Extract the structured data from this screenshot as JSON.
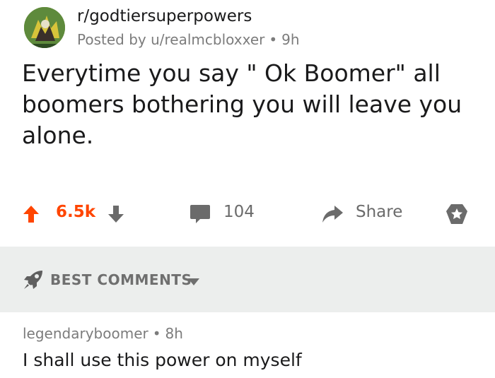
{
  "post": {
    "subreddit": "r/godtiersuperpowers",
    "posted_by": "Posted by u/realmcbloxxer",
    "age": "9h",
    "title": "Everytime you say \" Ok Boomer\" all boomers bothering you will leave you alone."
  },
  "actions": {
    "vote_count": "6.5k",
    "comment_count": "104",
    "share_label": "Share"
  },
  "sort": {
    "label": "BEST COMMENTS"
  },
  "comment": {
    "author": "legendaryboomer",
    "age": "8h",
    "body": "I shall use this power on myself"
  },
  "colors": {
    "upvote": "#ff4500",
    "muted": "#6b6b6b",
    "sort_bar": "#eceeed"
  },
  "icons": [
    "subreddit-avatar",
    "upvote-icon",
    "downvote-icon",
    "comment-icon",
    "share-icon",
    "award-icon",
    "rocket-icon",
    "caret-down-icon"
  ]
}
